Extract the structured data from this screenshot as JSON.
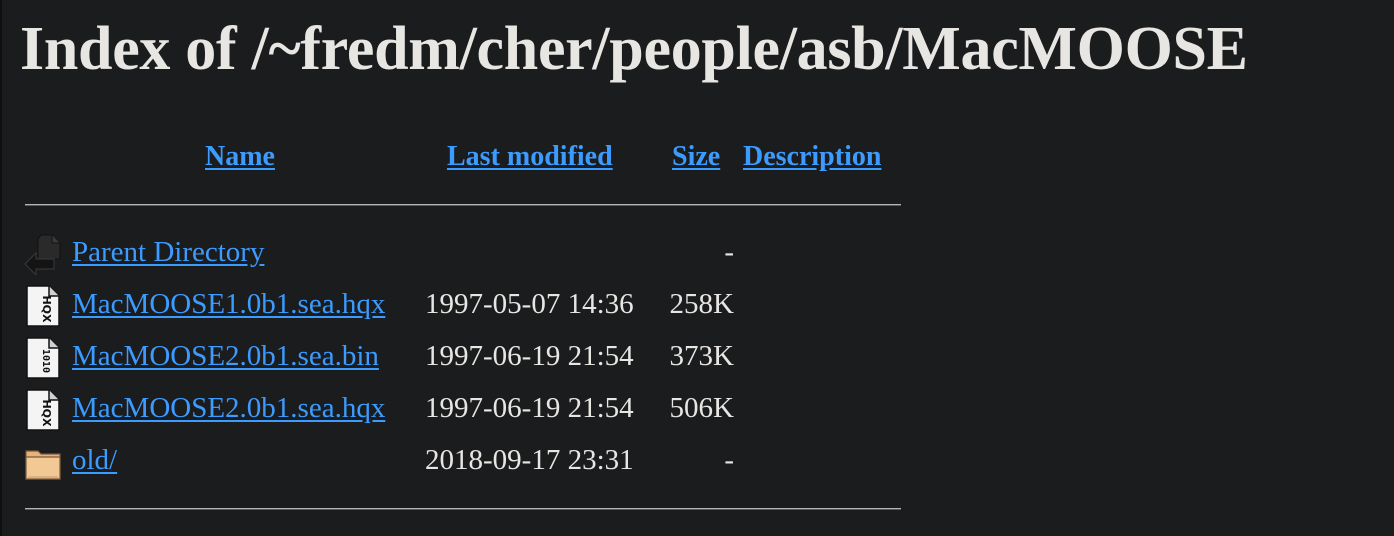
{
  "title": "Index of /~fredm/cher/people/asb/MacMOOSE",
  "columns": {
    "name": "Name",
    "last_modified": "Last modified",
    "size": "Size",
    "description": "Description"
  },
  "rows": [
    {
      "icon": "back-arrow-icon",
      "name": "Parent Directory",
      "modified": "",
      "size": "-",
      "description": ""
    },
    {
      "icon": "hqx-file-icon",
      "name": "MacMOOSE1.0b1.sea.hqx",
      "modified": "1997-05-07 14:36",
      "size": "258K",
      "description": ""
    },
    {
      "icon": "binary-file-icon",
      "name": "MacMOOSE2.0b1.sea.bin",
      "modified": "1997-06-19 21:54",
      "size": "373K",
      "description": ""
    },
    {
      "icon": "hqx-file-icon",
      "name": "MacMOOSE2.0b1.sea.hqx",
      "modified": "1997-06-19 21:54",
      "size": "506K",
      "description": ""
    },
    {
      "icon": "folder-icon",
      "name": "old/",
      "modified": "2018-09-17 23:31",
      "size": "-",
      "description": ""
    }
  ]
}
